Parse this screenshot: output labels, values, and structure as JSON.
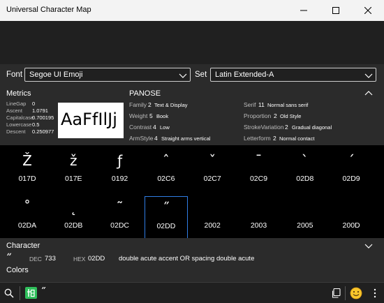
{
  "window": {
    "title": "Universal Character Map"
  },
  "font": {
    "label": "Font",
    "value": "Segoe UI Emoji"
  },
  "set": {
    "label": "Set",
    "value": "Latin Extended-A"
  },
  "metrics": {
    "heading": "Metrics",
    "rows": [
      {
        "name": "LineGap",
        "value": "0"
      },
      {
        "name": "Ascent",
        "value": "1.0791"
      },
      {
        "name": "Capitalcase",
        "value": "0.700195"
      },
      {
        "name": "Lowercase",
        "value": "0.5"
      },
      {
        "name": "Descent",
        "value": "0.250977"
      }
    ],
    "preview": "AaFfIlJj"
  },
  "panose": {
    "heading": "PANOSE",
    "left": [
      {
        "name": "Family",
        "num": "2",
        "desc": "Text & Display"
      },
      {
        "name": "Weight",
        "num": "5",
        "desc": "Book"
      },
      {
        "name": "Contrast",
        "num": "4",
        "desc": "Low"
      },
      {
        "name": "ArmStyle",
        "num": "4",
        "desc": "Straight arms vertical"
      }
    ],
    "right": [
      {
        "name": "Serif",
        "num": "11",
        "desc": "Normal sans serif"
      },
      {
        "name": "Proportion",
        "num": "2",
        "desc": "Old Style"
      },
      {
        "name": "StrokeVariation",
        "num": "2",
        "desc": "Gradual diagonal"
      },
      {
        "name": "Letterform",
        "num": "2",
        "desc": "Normal contact"
      }
    ]
  },
  "grid": {
    "selected": 11,
    "cells": [
      {
        "glyph": "Ž",
        "code": "017D"
      },
      {
        "glyph": "ž",
        "code": "017E"
      },
      {
        "glyph": "ƒ",
        "code": "0192"
      },
      {
        "glyph": "ˆ",
        "code": "02C6"
      },
      {
        "glyph": "ˇ",
        "code": "02C7"
      },
      {
        "glyph": "ˉ",
        "code": "02C9"
      },
      {
        "glyph": "ˋ",
        "code": "02D8"
      },
      {
        "glyph": "ˊ",
        "code": "02D9"
      },
      {
        "glyph": "˚",
        "code": "02DA"
      },
      {
        "glyph": "˛",
        "code": "02DB"
      },
      {
        "glyph": "˜",
        "code": "02DC"
      },
      {
        "glyph": "˝",
        "code": "02DD"
      },
      {
        "glyph": "",
        "code": "2002"
      },
      {
        "glyph": "",
        "code": "2003"
      },
      {
        "glyph": "",
        "code": "2005"
      },
      {
        "glyph": "",
        "code": "200D"
      }
    ]
  },
  "character": {
    "heading": "Character",
    "glyph": "˝",
    "dec_label": "DEC",
    "dec": "733",
    "hex_label": "HEX",
    "hex": "02DD",
    "description": "double acute accent OR spacing double acute",
    "colors_label": "Colors"
  },
  "bottombar": {
    "glyph": "˝"
  }
}
